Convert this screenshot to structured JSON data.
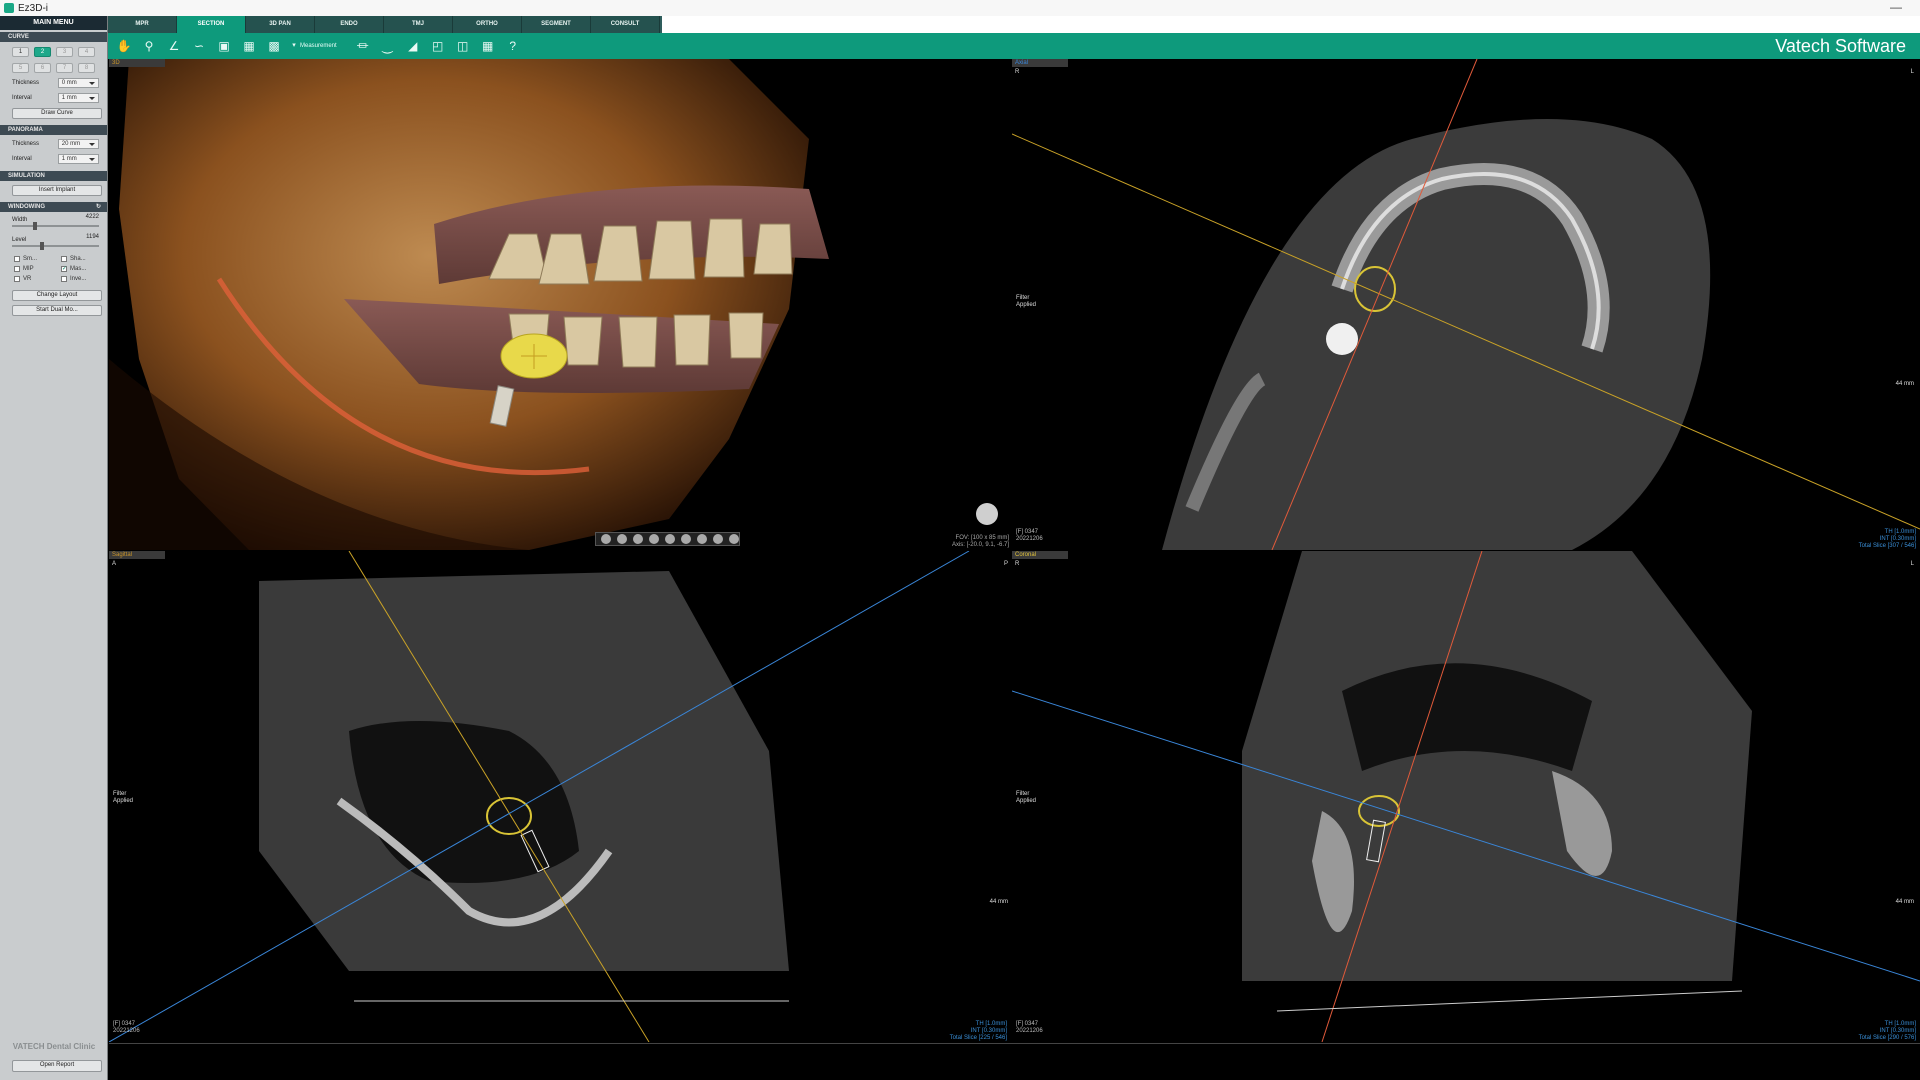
{
  "window": {
    "title": "Ez3D-i",
    "minimize": "—"
  },
  "sidebar": {
    "main_menu": "MAIN MENU",
    "curve": {
      "title": "CURVE",
      "buttons_row1": [
        "1",
        "2",
        "3",
        "4"
      ],
      "buttons_row2": [
        "5",
        "6",
        "7",
        "8"
      ],
      "thickness_label": "Thickness",
      "thickness_value": "0 mm",
      "interval_label": "Interval",
      "interval_value": "1 mm",
      "draw_curve": "Draw Curve"
    },
    "panorama": {
      "title": "PANORAMA",
      "thickness_label": "Thickness",
      "thickness_value": "20 mm",
      "interval_label": "Interval",
      "interval_value": "1 mm"
    },
    "simulation": {
      "title": "SIMULATION",
      "insert_implant": "Insert Implant"
    },
    "windowing": {
      "title": "WINDOWING",
      "width_label": "Width",
      "width_value": "4222",
      "level_label": "Level",
      "level_value": "1194",
      "checkboxes": [
        {
          "label": "Sm...",
          "checked": false
        },
        {
          "label": "Sha...",
          "checked": false
        },
        {
          "label": "MIP",
          "checked": false
        },
        {
          "label": "Mas...",
          "checked": true
        },
        {
          "label": "VR",
          "checked": false
        },
        {
          "label": "Inve...",
          "checked": false
        }
      ],
      "change_layout": "Change Layout",
      "start_dual": "Start Dual Mo..."
    },
    "clinic": "VATECH Dental Clinic",
    "open_report": "Open Report"
  },
  "tabs": [
    "MPR",
    "SECTION",
    "3D PAN",
    "ENDO",
    "TMJ",
    "ORTHO",
    "SEGMENT",
    "CONSULT"
  ],
  "active_tab": "SECTION",
  "toolbar": {
    "measurement": "Measurement",
    "brand": "Vatech Software"
  },
  "viewports": {
    "v3d": {
      "label": "3D",
      "fov": "FOV: [100 x 85 mm]",
      "axis": "Axis: [-20.0, 9.1, -6.7]"
    },
    "axial": {
      "label": "Axial",
      "left": "R",
      "right": "L",
      "filter": [
        "Filter",
        "Applied"
      ],
      "scale": "44 mm",
      "info_left": [
        "[F] 0347",
        "20221206"
      ],
      "info_right": [
        "TH [1.0mm]",
        "INT [0.30mm]",
        "Total Slice [307 / 546]"
      ]
    },
    "sagittal": {
      "label": "Sagittal",
      "left": "A",
      "right": "P",
      "filter": [
        "Filter",
        "Applied"
      ],
      "scale": "44 mm",
      "info_left": [
        "[F] 0347",
        "20221206"
      ],
      "info_right": [
        "TH [1.0mm]",
        "INT [0.30mm]",
        "Total Slice [225 / 546]"
      ]
    },
    "coronal": {
      "label": "Coronal",
      "left": "R",
      "right": "L",
      "filter": [
        "Filter",
        "Applied"
      ],
      "scale": "44 mm",
      "info_left": [
        "[F] 0347",
        "20221206"
      ],
      "info_right": [
        "TH [1.0mm]",
        "INT [0.30mm]",
        "Total Slice [290 / 576]"
      ]
    }
  },
  "colors": {
    "accent": "#0e9a7c",
    "sidebar": "#c9ccce",
    "axial_line": "#c9a227",
    "sagittal_line": "#3a86d8",
    "coronal_line": "#e05a3a"
  }
}
